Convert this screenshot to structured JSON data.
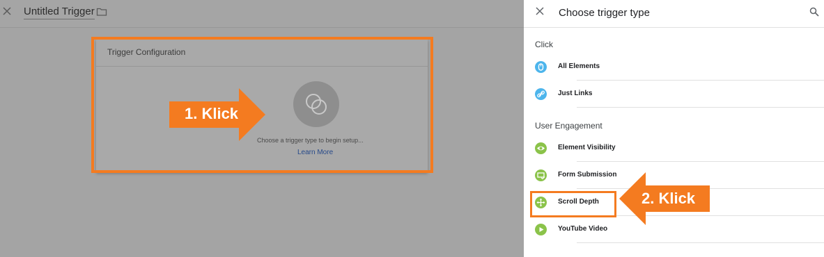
{
  "editor": {
    "title": "Untitled Trigger",
    "card_title": "Trigger Configuration",
    "hint": "Choose a trigger type to begin setup...",
    "learn_more": "Learn More"
  },
  "annotations": {
    "step1": "1. Klick",
    "step2": "2. Klick",
    "accent_color": "#f47b20"
  },
  "panel": {
    "title": "Choose trigger type",
    "sections": [
      {
        "label": "Click",
        "items": [
          {
            "label": "All Elements",
            "icon": "cursor-click-icon",
            "color": "#4db5ec"
          },
          {
            "label": "Just Links",
            "icon": "link-icon",
            "color": "#4db5ec"
          }
        ]
      },
      {
        "label": "User Engagement",
        "items": [
          {
            "label": "Element Visibility",
            "icon": "eye-icon",
            "color": "#8bc34a"
          },
          {
            "label": "Form Submission",
            "icon": "form-icon",
            "color": "#8bc34a"
          },
          {
            "label": "Scroll Depth",
            "icon": "move-arrows-icon",
            "color": "#8bc34a"
          },
          {
            "label": "YouTube Video",
            "icon": "play-icon",
            "color": "#8bc34a"
          }
        ]
      }
    ]
  }
}
